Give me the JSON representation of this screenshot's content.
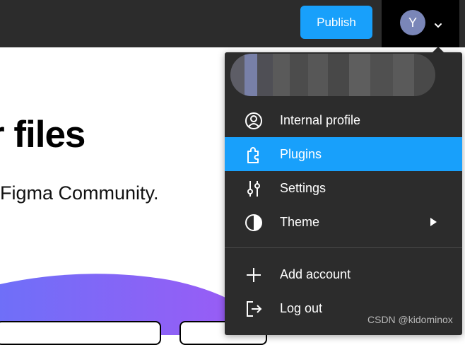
{
  "topbar": {
    "publish_label": "Publish",
    "avatar_initial": "Y",
    "colors": {
      "bar": "#2c2c2c",
      "publish": "#18a0fb",
      "avatar": "#7a86b8"
    }
  },
  "page": {
    "heading": "r files",
    "subheading": "Figma Community."
  },
  "menu": {
    "account_name": "",
    "items": [
      {
        "label": "Internal profile",
        "icon": "user-circle-icon",
        "active": false
      },
      {
        "label": "Plugins",
        "icon": "puzzle-icon",
        "active": true
      },
      {
        "label": "Settings",
        "icon": "sliders-icon",
        "active": false
      },
      {
        "label": "Theme",
        "icon": "half-circle-icon",
        "active": false,
        "has_submenu": true
      },
      {
        "label": "Add account",
        "icon": "plus-icon",
        "active": false
      },
      {
        "label": "Log out",
        "icon": "logout-icon",
        "active": false
      }
    ],
    "colors": {
      "background": "#2c2c2c",
      "highlight": "#18a0fb",
      "text": "#ffffff"
    }
  },
  "watermark": "CSDN @kidominox"
}
